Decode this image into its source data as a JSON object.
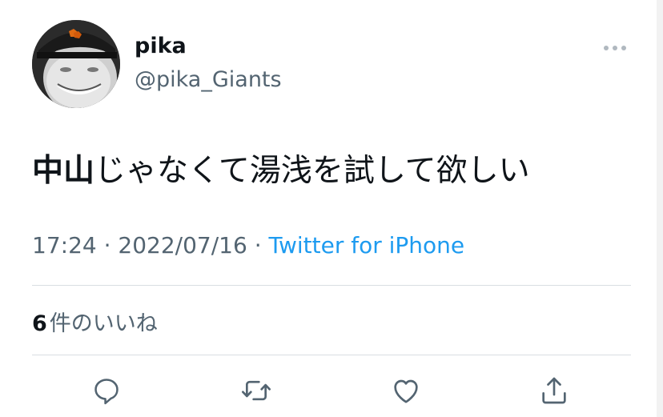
{
  "user": {
    "display_name": "pika",
    "handle": "@pika_Giants"
  },
  "tweet": {
    "text_bold": "中山",
    "text_rest": "じゃなくて湯浅を試して欲しい"
  },
  "meta": {
    "time": "17:24",
    "separator": " · ",
    "date": "2022/07/16",
    "source": "Twitter for iPhone"
  },
  "likes": {
    "count": "6",
    "label": "件のいいね"
  },
  "actions": {
    "icons": [
      "reply-icon",
      "retweet-icon",
      "like-icon",
      "share-icon"
    ]
  },
  "colors": {
    "text": "#0f1419",
    "secondary": "#536471",
    "link": "#1d9bf0",
    "divider": "#d9dee2"
  }
}
